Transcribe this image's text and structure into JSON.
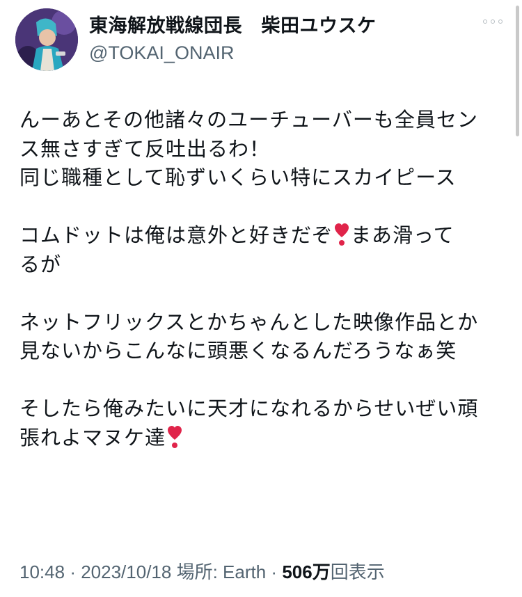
{
  "user": {
    "display_name": "東海解放戦線団長　柴田ユウスケ",
    "handle": "@TOKAI_ONAIR"
  },
  "tweet": {
    "lines": [
      "んーあとその他諸々のユーチューバーも全員セン",
      "ス無さすぎて反吐出るわ！",
      "同じ職種として恥ずいくらい特にスカイピース",
      "",
      "コムドットは俺は意外と好きだぞ",
      "まあ滑って",
      "るが",
      "",
      "ネットフリックスとかちゃんとした映像作品とか",
      "見ないからこんなに頭悪くなるんだろうなぁ笑",
      "",
      "そしたら俺みたいに天才になれるからせいぜい頑",
      "張れよマヌケ達"
    ]
  },
  "meta": {
    "time": "10:48",
    "date": "2023/10/18",
    "location_label": "場所: Earth",
    "views_count": "506",
    "views_unit": "万",
    "views_label": "回表示",
    "separator": "·"
  },
  "icons": {
    "more": "more-options-icon",
    "heart": "heavy-heart-exclamation-icon",
    "heart_color": "#e0244a"
  }
}
